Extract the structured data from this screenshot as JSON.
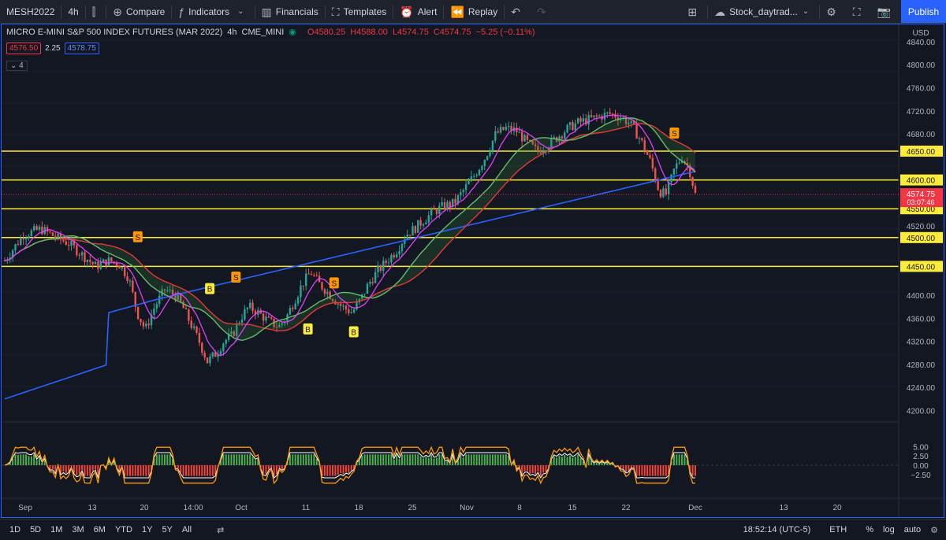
{
  "toolbar": {
    "symbol": "MESH2022",
    "interval": "4h",
    "compare": "Compare",
    "indicators": "Indicators",
    "financials": "Financials",
    "templates": "Templates",
    "alert": "Alert",
    "replay": "Replay",
    "layout_name": "Stock_daytrad...",
    "publish": "Publish"
  },
  "legend": {
    "title": "MICRO E-MINI S&P 500 INDEX FUTURES (MAR 2022)",
    "interval": "4h",
    "exchange": "CME_MINI",
    "open": "O4580.25",
    "high": "H4588.00",
    "low": "L4574.75",
    "close": "C4574.75",
    "change": "−5.25 (−0.11%)",
    "bid": "4576.50",
    "spread": "2.25",
    "ask": "4578.75",
    "collapsed_count": "4"
  },
  "colors": {
    "up": "#26a69a",
    "down": "#ef5350",
    "ma200": "#2962ff",
    "level": "#ffeb3b",
    "accent": "#2962ff"
  },
  "price_axis": {
    "currency": "USD",
    "last_price": "4574.75",
    "countdown": "03:07:46",
    "labels": [
      "4840.00",
      "4800.00",
      "4760.00",
      "4720.00",
      "4680.00",
      "4650.00",
      "4600.00",
      "4550.00",
      "4520.00",
      "4500.00",
      "4450.00",
      "4400.00",
      "4360.00",
      "4320.00",
      "4280.00",
      "4240.00",
      "4200.00"
    ],
    "osc_labels": [
      "5.00",
      "2.50",
      "0.00",
      "−2.50"
    ]
  },
  "time_axis": [
    "Sep",
    "13",
    "20",
    "14:00",
    "Oct",
    "11",
    "18",
    "25",
    "Nov",
    "8",
    "15",
    "22",
    "Dec",
    "13",
    "20"
  ],
  "bottom": {
    "ranges": [
      "1D",
      "5D",
      "1M",
      "3M",
      "6M",
      "YTD",
      "1Y",
      "5Y",
      "All"
    ],
    "clock": "18:52:14 (UTC-5)",
    "session": "ETH",
    "percent": "%",
    "log": "log",
    "auto": "auto"
  },
  "chart_data": {
    "type": "candlestick",
    "horizontal_levels": [
      4650,
      4600,
      4550,
      4500,
      4450
    ],
    "ylim": [
      4180,
      4870
    ],
    "close_path": [
      [
        0,
        4460
      ],
      [
        18,
        4505
      ],
      [
        35,
        4515
      ],
      [
        50,
        4500
      ],
      [
        62,
        4490
      ],
      [
        75,
        4470
      ],
      [
        88,
        4450
      ],
      [
        100,
        4460
      ],
      [
        110,
        4455
      ],
      [
        120,
        4430
      ],
      [
        128,
        4370
      ],
      [
        136,
        4340
      ],
      [
        145,
        4380
      ],
      [
        155,
        4410
      ],
      [
        165,
        4400
      ],
      [
        172,
        4380
      ],
      [
        180,
        4350
      ],
      [
        188,
        4320
      ],
      [
        196,
        4285
      ],
      [
        205,
        4300
      ],
      [
        212,
        4320
      ],
      [
        220,
        4330
      ],
      [
        228,
        4360
      ],
      [
        236,
        4380
      ],
      [
        245,
        4370
      ],
      [
        255,
        4355
      ],
      [
        265,
        4345
      ],
      [
        272,
        4360
      ],
      [
        280,
        4390
      ],
      [
        288,
        4420
      ],
      [
        296,
        4440
      ],
      [
        304,
        4420
      ],
      [
        315,
        4400
      ],
      [
        326,
        4380
      ],
      [
        336,
        4370
      ],
      [
        345,
        4395
      ],
      [
        352,
        4420
      ],
      [
        360,
        4440
      ],
      [
        370,
        4460
      ],
      [
        380,
        4480
      ],
      [
        388,
        4505
      ],
      [
        396,
        4515
      ],
      [
        405,
        4530
      ],
      [
        415,
        4545
      ],
      [
        425,
        4555
      ],
      [
        435,
        4560
      ],
      [
        445,
        4585
      ],
      [
        455,
        4610
      ],
      [
        465,
        4640
      ],
      [
        475,
        4680
      ],
      [
        485,
        4690
      ],
      [
        495,
        4685
      ],
      [
        505,
        4665
      ],
      [
        515,
        4650
      ],
      [
        525,
        4660
      ],
      [
        535,
        4675
      ],
      [
        545,
        4690
      ],
      [
        555,
        4700
      ],
      [
        565,
        4705
      ],
      [
        575,
        4710
      ],
      [
        585,
        4715
      ],
      [
        595,
        4710
      ],
      [
        605,
        4698
      ],
      [
        615,
        4670
      ],
      [
        625,
        4630
      ],
      [
        633,
        4580
      ],
      [
        640,
        4575
      ],
      [
        648,
        4620
      ],
      [
        655,
        4640
      ],
      [
        662,
        4620
      ],
      [
        668,
        4575
      ]
    ],
    "signals": [
      {
        "label": "S",
        "x_index": 16,
        "price": 4500
      },
      {
        "label": "B",
        "x_index": 27,
        "price": 4410
      },
      {
        "label": "S",
        "x_index": 31,
        "price": 4430
      },
      {
        "label": "B",
        "x_index": 42,
        "price": 4340
      },
      {
        "label": "S",
        "x_index": 46,
        "price": 4420
      },
      {
        "label": "B",
        "x_index": 49,
        "price": 4335
      },
      {
        "label": "S",
        "x_index": 98,
        "price": 4680
      }
    ]
  }
}
